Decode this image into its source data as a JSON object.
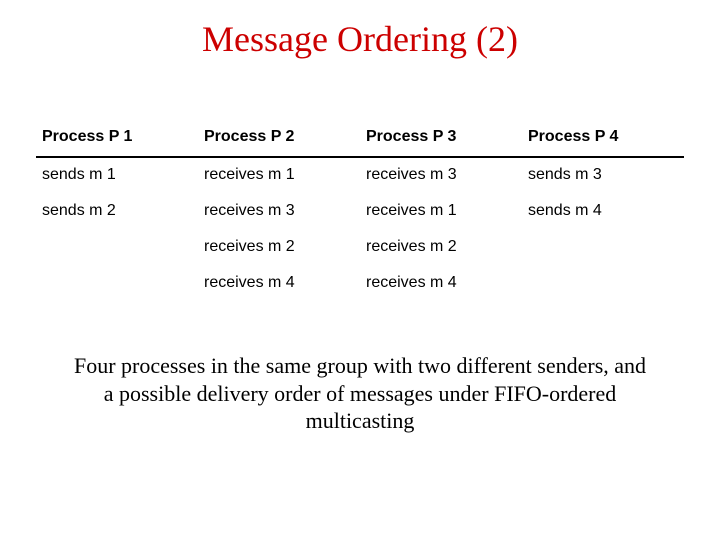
{
  "title": "Message Ordering (2)",
  "table": {
    "headers": [
      "Process P 1",
      "Process P 2",
      "Process P 3",
      "Process P 4"
    ],
    "rows": [
      [
        "sends m 1",
        "receives m 1",
        "receives m 3",
        "sends m 3"
      ],
      [
        "sends m 2",
        "receives m 3",
        "receives m 1",
        "sends m 4"
      ],
      [
        "",
        "receives m 2",
        "receives m 2",
        ""
      ],
      [
        "",
        "receives m 4",
        "receives m 4",
        ""
      ]
    ]
  },
  "caption": "Four processes in the same group with two different senders, and a possible delivery order of messages under FIFO-ordered multicasting"
}
